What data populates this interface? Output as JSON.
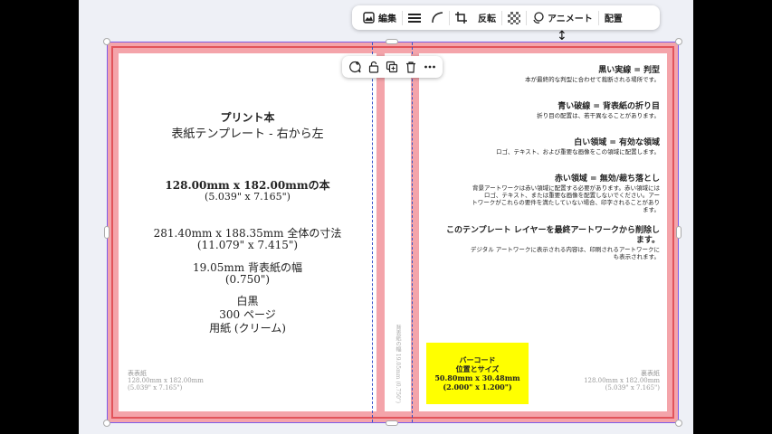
{
  "toolbar": {
    "edit_label": "編集",
    "flip_label": "反転",
    "animate_label": "アニメート",
    "position_label": "配置"
  },
  "back": {
    "title": "プリント本",
    "subtitle": "表紙テンプレート - 右から左",
    "size_line1": "128.00mm x 182.00mmの本",
    "size_line2": "(5.039\" x 7.165\")",
    "total_line1": "281.40mm x 188.35mm 全体の寸法",
    "total_line2": "(11.079\" x 7.415\")",
    "spine_line1": "19.05mm 背表紙の幅",
    "spine_line2": "(0.750\")",
    "color": "白黒",
    "pages": "300 ページ",
    "paper": "用紙 (クリーム)",
    "corner_label": "表表紙",
    "corner_size1": "128.00mm x 182.00mm",
    "corner_size2": "(5.039\" x 7.165\")"
  },
  "spine": {
    "text": "背表紙の幅 19.05mm (0.750\")"
  },
  "front": {
    "legend": [
      {
        "heading": "黒い実線 = 判型",
        "body": [
          "本が最終的な判型に合わせて裁断される場所です。"
        ]
      },
      {
        "heading": "青い破線 = 背表紙の折り目",
        "body": [
          "折り目の配置は、若干異なることがあります。"
        ]
      },
      {
        "heading": "白い領域 = 有効な領域",
        "body": [
          "ロゴ、テキスト、および重要な画像をこの領域に配置します。"
        ]
      },
      {
        "heading": "赤い領域 = 無効/裁ち落とし",
        "body": [
          "背景アートワークは赤い領域に配置する必要があります。赤い領域には",
          "ロゴ、テキスト、または重要な画像を配置しないでください。アー",
          "トワークがこれらの要件を満たしていない場合、印字されることがあり",
          "ます。"
        ]
      },
      {
        "heading": "このテンプレート レイヤーを最終アートワークから削除し",
        "heading2": "ます。",
        "body": [
          "デジタル アートワークに表示される内容は、印刷されるアートワークに",
          "も表示されます。"
        ]
      }
    ],
    "barcode": {
      "line1": "バーコード",
      "line2": "位置とサイズ",
      "line3": "50.80mm x 30.48mm",
      "line4": "(2.000\" x 1.200\")"
    },
    "corner_label": "裏表紙",
    "corner_size1": "128.00mm x 182.00mm",
    "corner_size2": "(5.039\" x 7.165\")"
  },
  "colors": {
    "bleed": "#f4a4aa",
    "trim": "#e2545b",
    "fold": "#3553c9",
    "barcode": "#ffff00",
    "selection": "#7d5ce8"
  }
}
